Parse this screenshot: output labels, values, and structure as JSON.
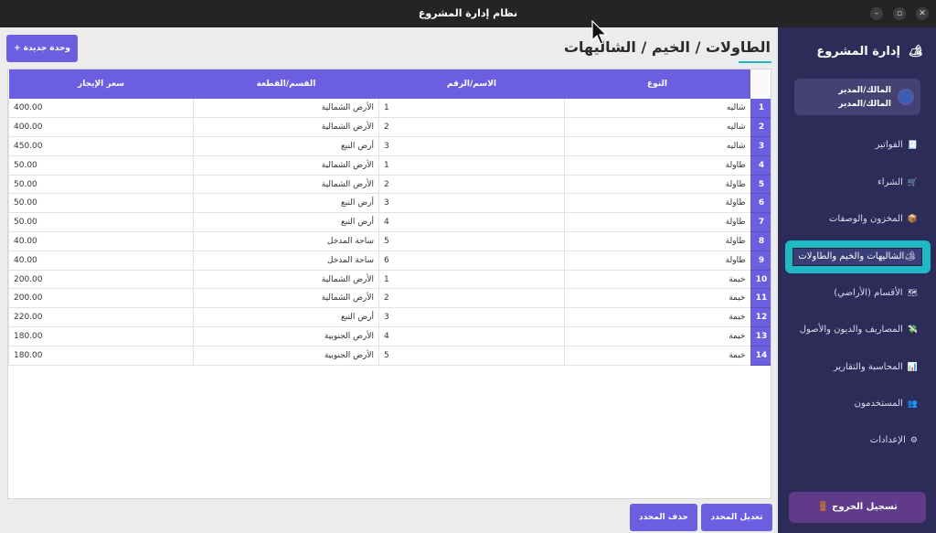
{
  "window": {
    "title": "نظام إدارة المشروع",
    "controls": {
      "minimize": "–",
      "maximize": "▫",
      "close": "✕"
    }
  },
  "sidebar": {
    "brand": {
      "icon": "🏕",
      "label": "إدارة المشروع"
    },
    "user": {
      "role1": "المالك/المدير",
      "role2": "المالك/المدير"
    },
    "items": [
      {
        "icon": "🧾",
        "label": "الفواتير"
      },
      {
        "icon": "🛒",
        "label": "الشراء"
      },
      {
        "icon": "📦",
        "label": "المخزون والوصفات"
      },
      {
        "icon": "🏕",
        "label": "الشاليهات والخيم والطاولات",
        "active": true
      },
      {
        "icon": "🗺",
        "label": "الأقسام (الأراضي)"
      },
      {
        "icon": "💸",
        "label": "المصاريف والديون والأصول"
      },
      {
        "icon": "📊",
        "label": "المحاسبة والتقارير"
      },
      {
        "icon": "👥",
        "label": "المستخدمون"
      },
      {
        "icon": "⚙",
        "label": "الإعدادات"
      }
    ],
    "logout": {
      "icon": "🚪",
      "label": "تسجيل الخروج"
    }
  },
  "main": {
    "title": "الطاولات / الخيم / الشاليهات",
    "new_button": "+ وحدة جديدة",
    "edit_button": "تعديل المحدد",
    "delete_button": "حذف المحدد",
    "accent": "#6b5ee0",
    "table": {
      "headers": {
        "type": "النوع",
        "name": "الاسم/الرقم",
        "section": "القسم/القطعة",
        "price": "سعر الإيجار"
      },
      "rows": [
        {
          "n": "1",
          "type": "شاليه",
          "name": "1",
          "section": "الأرض الشمالية",
          "price": "400.00"
        },
        {
          "n": "2",
          "type": "شاليه",
          "name": "2",
          "section": "الأرض الشمالية",
          "price": "400.00"
        },
        {
          "n": "3",
          "type": "شاليه",
          "name": "3",
          "section": "أرض النبع",
          "price": "450.00"
        },
        {
          "n": "4",
          "type": "طاولة",
          "name": "1",
          "section": "الأرض الشمالية",
          "price": "50.00"
        },
        {
          "n": "5",
          "type": "طاولة",
          "name": "2",
          "section": "الأرض الشمالية",
          "price": "50.00"
        },
        {
          "n": "6",
          "type": "طاولة",
          "name": "3",
          "section": "أرض النبع",
          "price": "50.00"
        },
        {
          "n": "7",
          "type": "طاولة",
          "name": "4",
          "section": "أرض النبع",
          "price": "50.00"
        },
        {
          "n": "8",
          "type": "طاولة",
          "name": "5",
          "section": "ساحة المدخل",
          "price": "40.00"
        },
        {
          "n": "9",
          "type": "طاولة",
          "name": "6",
          "section": "ساحة المدخل",
          "price": "40.00"
        },
        {
          "n": "10",
          "type": "خيمة",
          "name": "1",
          "section": "الأرض الشمالية",
          "price": "200.00"
        },
        {
          "n": "11",
          "type": "خيمة",
          "name": "2",
          "section": "الأرض الشمالية",
          "price": "200.00"
        },
        {
          "n": "12",
          "type": "خيمة",
          "name": "3",
          "section": "أرض النبع",
          "price": "220.00"
        },
        {
          "n": "13",
          "type": "خيمة",
          "name": "4",
          "section": "الأرض الجنوبية",
          "price": "180.00"
        },
        {
          "n": "14",
          "type": "خيمة",
          "name": "5",
          "section": "الأرض الجنوبية",
          "price": "180.00"
        }
      ]
    }
  }
}
